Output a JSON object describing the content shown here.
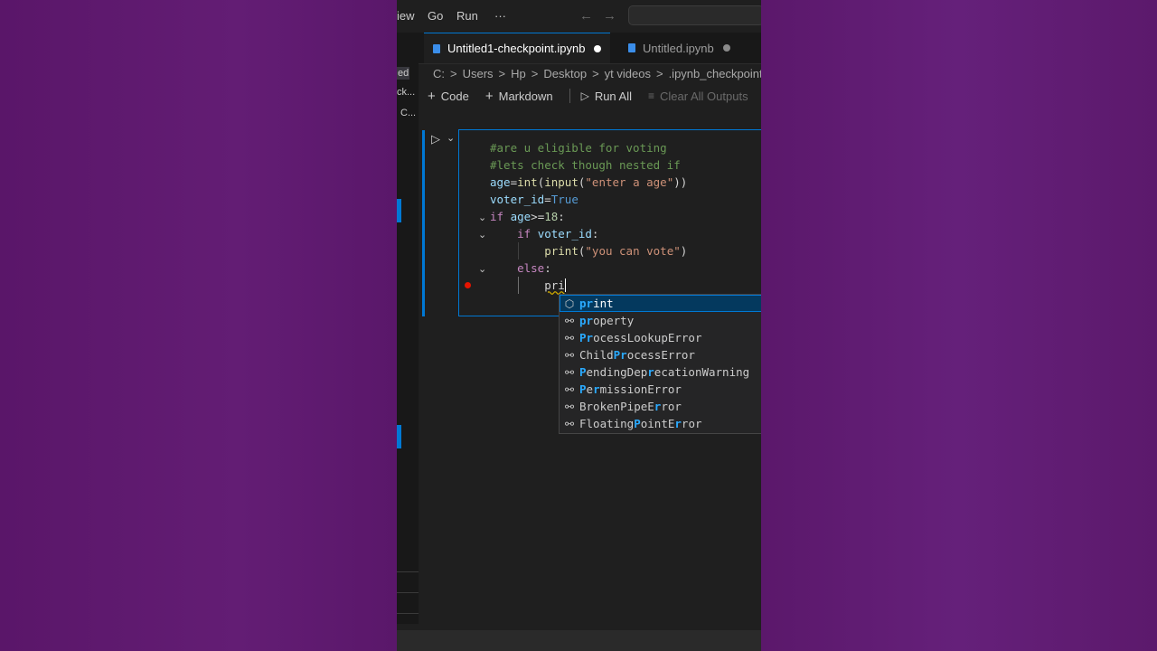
{
  "menu": {
    "view": "iew",
    "go": "Go",
    "run": "Run",
    "more": "···"
  },
  "tabs": [
    {
      "label": "Untitled1-checkpoint.ipynb",
      "active": true
    },
    {
      "label": "Untitled.ipynb",
      "active": false
    }
  ],
  "breadcrumb": [
    "C:",
    ">",
    "Users",
    ">",
    "Hp",
    ">",
    "Desktop",
    ">",
    "yt videos",
    ">",
    ".ipynb_checkpoints",
    ">"
  ],
  "toolbar": {
    "code": "Code",
    "markdown": "Markdown",
    "run_all": "Run All",
    "clear_outputs": "Clear All Outputs"
  },
  "left_fragments": [
    "ed",
    "ck...",
    "C..."
  ],
  "code_lines": {
    "l1": "#are u eligible for voting",
    "l2": "#lets check though nested if",
    "l3a": "age",
    "l3b": "=",
    "l3c": "int",
    "l3d": "(",
    "l3e": "input",
    "l3f": "(",
    "l3g": "\"enter a age\"",
    "l3h": "))",
    "l4a": "voter_id",
    "l4b": "=",
    "l4c": "True",
    "l5a": "if",
    "l5b": " age",
    "l5c": ">=",
    "l5d": "18",
    "l5e": ":",
    "l6a": "if",
    "l6b": " voter_id",
    "l6c": ":",
    "l7a": "print",
    "l7b": "(",
    "l7c": "\"you can vote\"",
    "l7d": ")",
    "l8a": "else",
    "l8b": ":",
    "l9": "pri"
  },
  "suggestions": [
    {
      "pre": "",
      "match": "pr",
      "post": "int",
      "icon": "cube-icon",
      "full": "print"
    },
    {
      "pre": "",
      "match": "pr",
      "post": "operty",
      "icon": "class-icon",
      "full": "property"
    },
    {
      "pre": "",
      "match": "Pr",
      "post": "ocessLookupError",
      "icon": "class-icon",
      "full": "ProcessLookupError"
    },
    {
      "pre": "Child",
      "match": "Pr",
      "post": "ocessError",
      "icon": "class-icon",
      "full": "ChildProcessError"
    },
    {
      "pre": "",
      "match": "P",
      "post": "endingDep",
      "match2": "r",
      "post2": "ecationWarning",
      "icon": "class-icon",
      "full": "PendingDeprecationWarning"
    },
    {
      "pre": "",
      "match": "P",
      "post": "e",
      "match2": "r",
      "post2": "missionError",
      "icon": "class-icon",
      "full": "PermissionError"
    },
    {
      "pre": "BrokenPipeE",
      "match": "r",
      "post": "ror",
      "icon": "class-icon",
      "full": "BrokenPipeError"
    },
    {
      "pre": "Floating",
      "match": "P",
      "post": "ointE",
      "match2": "r",
      "post2": "ror",
      "icon": "class-icon",
      "full": "FloatingPointError"
    }
  ],
  "colors": {
    "accent": "#0078d4",
    "background": "#5e1a6e",
    "editor": "#1f1f1f"
  }
}
